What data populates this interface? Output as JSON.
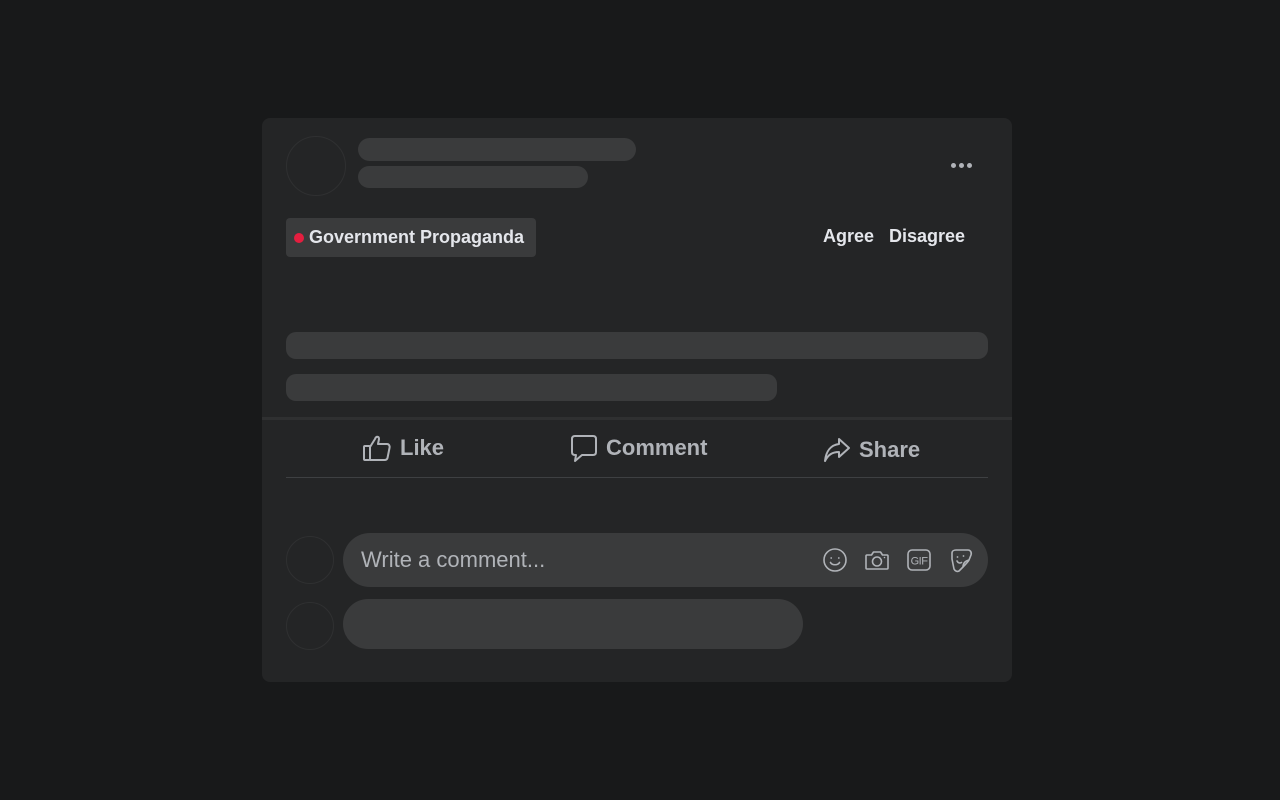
{
  "post": {
    "badge": {
      "label": "Government Propaganda",
      "dot_color": "#e41e3f"
    },
    "votes": {
      "agree": "Agree",
      "disagree": "Disagree"
    },
    "more_icon": "more-horizontal-icon"
  },
  "actions": {
    "like": {
      "label": "Like",
      "icon": "thumbs-up-icon"
    },
    "comment": {
      "label": "Comment",
      "icon": "comment-bubble-icon"
    },
    "share": {
      "label": "Share",
      "icon": "share-arrow-icon"
    }
  },
  "comment_composer": {
    "placeholder": "Write a comment...",
    "value": "",
    "icons": [
      "emoji-icon",
      "camera-icon",
      "gif-icon",
      "sticker-icon"
    ]
  },
  "colors": {
    "page_bg": "#18191a",
    "card_bg": "#242526",
    "skeleton": "#3a3b3c",
    "text_primary": "#e4e6eb",
    "text_secondary": "#b0b3b8"
  }
}
